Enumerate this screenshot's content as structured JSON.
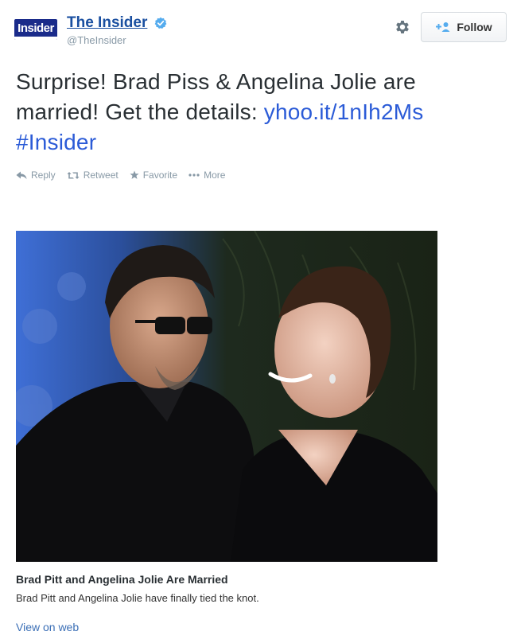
{
  "header": {
    "avatar_text": "Insider",
    "display_name": "The Insider",
    "handle": "@TheInsider",
    "follow_label": "Follow"
  },
  "tweet": {
    "text_part1": "Surprise! Brad Piss & Angelina Jolie are married! Get the details: ",
    "link": "yhoo.it/1nIh2Ms",
    "hashtag": "#Insider"
  },
  "actions": [
    {
      "label": "Reply",
      "icon": "reply-icon"
    },
    {
      "label": "Retweet",
      "icon": "retweet-icon"
    },
    {
      "label": "Favorite",
      "icon": "star-icon"
    },
    {
      "label": "More",
      "icon": "more-icon"
    }
  ],
  "card": {
    "title": "Brad Pitt and Angelina Jolie Are Married",
    "description": "Brad Pitt and Angelina Jolie have finally tied the knot.",
    "view_on_web": "View on web"
  },
  "colors": {
    "link": "#2b5bd7",
    "name": "#1a4fa0",
    "muted": "#8899a6",
    "verified": "#55acee",
    "avatar_bg": "#1a2b8a"
  }
}
